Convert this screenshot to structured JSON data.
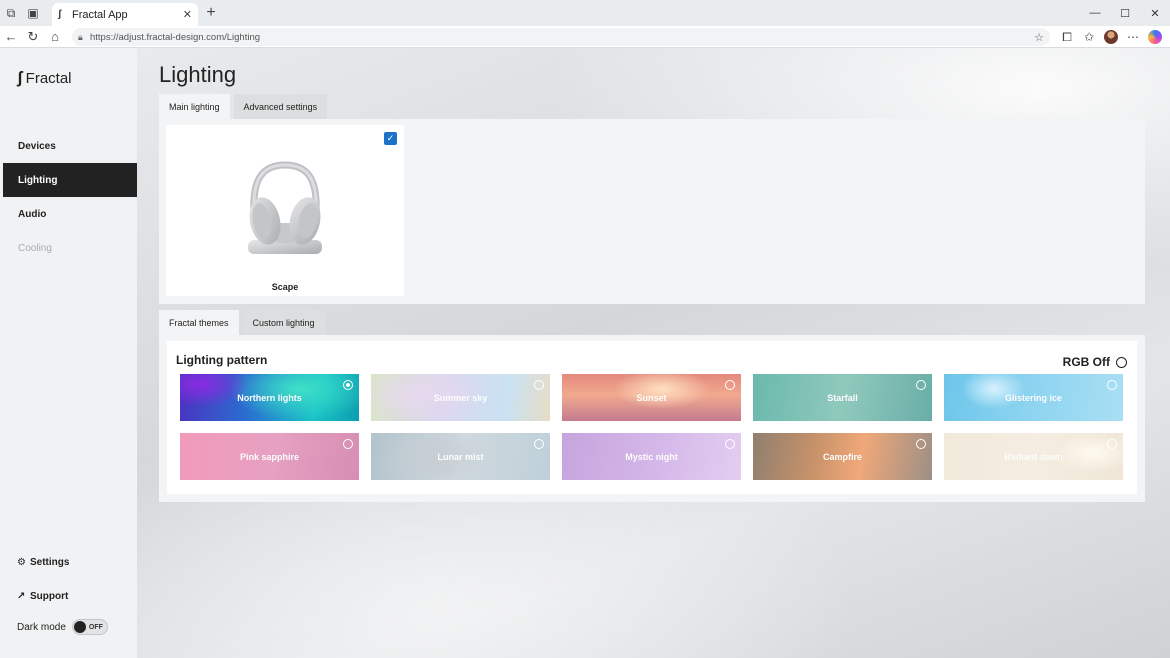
{
  "browser": {
    "tab_title": "Fractal App",
    "url": "https://adjust.fractal-design.com/Lighting",
    "icons": [
      "workspaces-icon",
      "tab-actions-icon",
      "back-icon",
      "refresh-icon",
      "home-icon",
      "lock-icon",
      "favorite-star-icon",
      "extensions-icon",
      "favorites-icon",
      "profile-avatar",
      "more-icon",
      "copilot-icon"
    ]
  },
  "sidebar": {
    "logo": "Fractal",
    "items": [
      {
        "label": "Devices"
      },
      {
        "label": "Lighting"
      },
      {
        "label": "Audio"
      },
      {
        "label": "Cooling"
      }
    ],
    "settings_label": "Settings",
    "support_label": "Support",
    "dark_mode_label": "Dark mode",
    "dark_mode_state": "OFF"
  },
  "main": {
    "title": "Lighting",
    "top_tabs": [
      "Main lighting",
      "Advanced settings"
    ],
    "device": {
      "name": "Scape",
      "selected": true
    },
    "theme_tabs": [
      "Fractal themes",
      "Custom lighting"
    ],
    "pattern_title": "Lighting pattern",
    "rgb_off_label": "RGB Off",
    "patterns": [
      {
        "label": "Northern lights",
        "selected": true
      },
      {
        "label": "Summer sky",
        "selected": false
      },
      {
        "label": "Sunset",
        "selected": false
      },
      {
        "label": "Starfall",
        "selected": false
      },
      {
        "label": "Glistering ice",
        "selected": false
      },
      {
        "label": "Pink sapphire",
        "selected": false
      },
      {
        "label": "Lunar mist",
        "selected": false
      },
      {
        "label": "Mystic night",
        "selected": false
      },
      {
        "label": "Campfire",
        "selected": false
      },
      {
        "label": "Radiant dawn",
        "selected": false
      }
    ]
  },
  "colors": {
    "active_nav": "#222222",
    "checkbox_accent": "#1a73c8"
  }
}
